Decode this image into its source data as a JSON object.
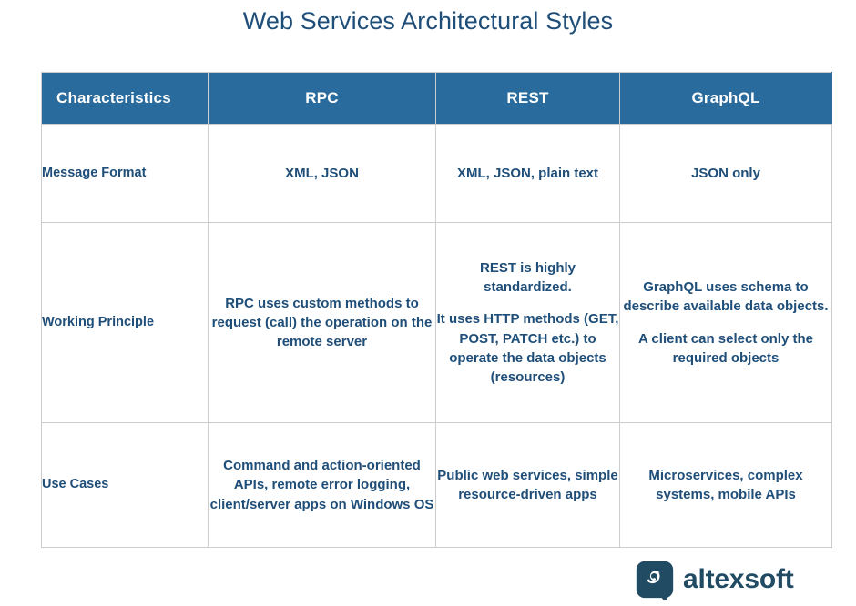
{
  "page": {
    "title": "Web Services Architectural Styles",
    "background_color": "#ffffff",
    "title_color": "#1f4e79",
    "header_color": "#2a6b9e",
    "border_color": "#cdcdcd",
    "text_color": "#1f4e79"
  },
  "table": {
    "columns": [
      {
        "key": "characteristics",
        "label": "Characteristics",
        "align": "left"
      },
      {
        "key": "rpc",
        "label": "RPC",
        "align": "center"
      },
      {
        "key": "rest",
        "label": "REST",
        "align": "center"
      },
      {
        "key": "graphql",
        "label": "GraphQL",
        "align": "center"
      }
    ],
    "rows": [
      {
        "label": "Message Format",
        "rpc": [
          "XML, JSON"
        ],
        "rest": [
          "XML, JSON, plain text"
        ],
        "graphql": [
          "JSON only"
        ]
      },
      {
        "label": "Working Principle",
        "rpc": [
          "RPC uses custom methods to request (call) the operation on the remote server"
        ],
        "rest": [
          "REST is highly standardized.",
          "It uses HTTP methods (GET, POST, PATCH etc.) to operate the data objects (resources)"
        ],
        "graphql": [
          "GraphQL uses schema to describe available data objects.",
          "A client can select only the required objects"
        ]
      },
      {
        "label": "Use Cases",
        "rpc": [
          "Command and action-oriented APIs, remote error logging, client/server apps on Windows OS"
        ],
        "rest": [
          "Public web services, simple resource-driven apps"
        ],
        "graphql": [
          "Microservices, complex systems, mobile APIs"
        ]
      }
    ]
  },
  "brand": {
    "name": "altexsoft",
    "icon": "altexsoft-speech-bubble-logo",
    "color": "#214a63"
  }
}
